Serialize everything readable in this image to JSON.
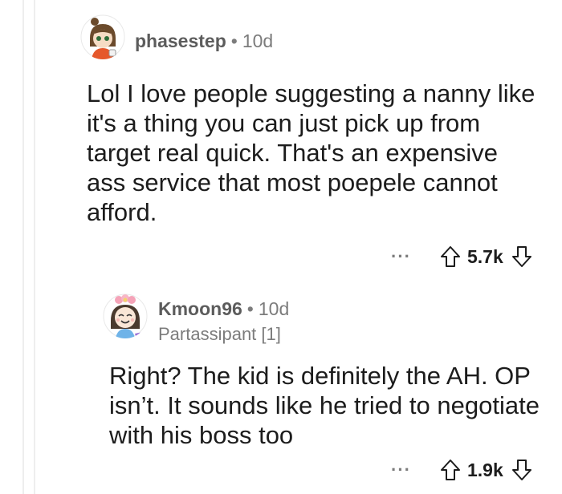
{
  "comments": [
    {
      "username": "phasestep",
      "separator": "•",
      "age": "10d",
      "body": "Lol I love people suggesting a nanny like it's a thing you can just pick up from target real quick. That's an expensive ass service that most poepele cannot afford.",
      "more_label": "···",
      "score": "5.7k"
    },
    {
      "username": "Kmoon96",
      "separator": "•",
      "age": "10d",
      "flair": "Partassipant [1]",
      "body": "Right? The kid is definitely the AH. OP isn’t. It sounds like he tried to negotiate with his boss too",
      "more_label": "···",
      "score": "1.9k"
    }
  ],
  "colors": {
    "username": "#5c5c5c",
    "meta": "#7c7c7c",
    "text": "#1c1c1c",
    "thread_line": "#eeeeee"
  },
  "icons": {
    "upvote": "arrow-up-outline-icon",
    "downvote": "arrow-down-outline-icon"
  }
}
